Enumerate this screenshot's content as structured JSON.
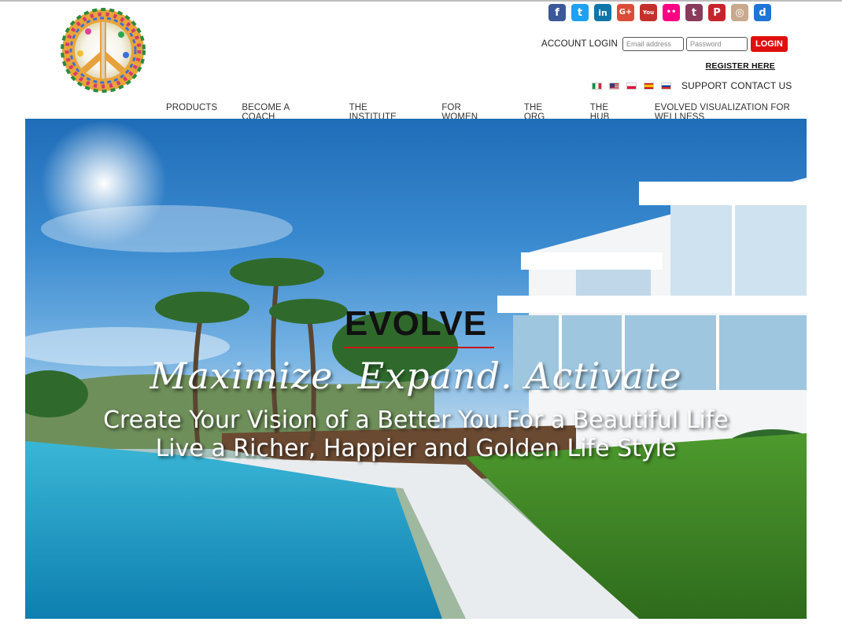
{
  "logo": {
    "alt": "evolvedlifevisions.com"
  },
  "social": [
    {
      "name": "facebook-icon",
      "glyph": "f",
      "color": "#3b5998"
    },
    {
      "name": "twitter-icon",
      "glyph": "t",
      "color": "#1da1f2"
    },
    {
      "name": "linkedin-icon",
      "glyph": "in",
      "color": "#0e76a8"
    },
    {
      "name": "googleplus-icon",
      "glyph": "G+",
      "color": "#dd4b39"
    },
    {
      "name": "youtube-icon",
      "glyph": "You",
      "color": "#c4302b"
    },
    {
      "name": "flickr-icon",
      "glyph": "••",
      "color": "#ff0084"
    },
    {
      "name": "tumblr-icon",
      "glyph": "t",
      "color": "#8a3a5a"
    },
    {
      "name": "pinterest-icon",
      "glyph": "P",
      "color": "#c8232c"
    },
    {
      "name": "instagram-icon",
      "glyph": "◎",
      "color": "#c9a98e"
    },
    {
      "name": "delicious-icon",
      "glyph": "d",
      "color": "#1f74d8"
    }
  ],
  "login": {
    "label": "ACCOUNT LOGIN",
    "email_placeholder": "Email address",
    "password_placeholder": "Password",
    "button": "LOGIN"
  },
  "register": "REGISTER HERE",
  "flags": [
    "italy-flag",
    "usa-flag",
    "poland-flag",
    "spain-flag",
    "russia-flag"
  ],
  "support": "SUPPORT",
  "contact": "CONTACT US",
  "nav": [
    "PRODUCTS",
    "BECOME A COACH",
    "THE INSTITUTE",
    "FOR WOMEN",
    "THE ORG",
    "THE HUB",
    "EVOLVED VISUALIZATION FOR WELLNESS"
  ],
  "hero": {
    "heading": "EVOLVE",
    "tagline": "Maximize. Expand. Activate",
    "line1": "Create Your Vision of a Better You For a Beautiful Life",
    "line2": "Live a Richer, Happier and Golden Life Style"
  }
}
